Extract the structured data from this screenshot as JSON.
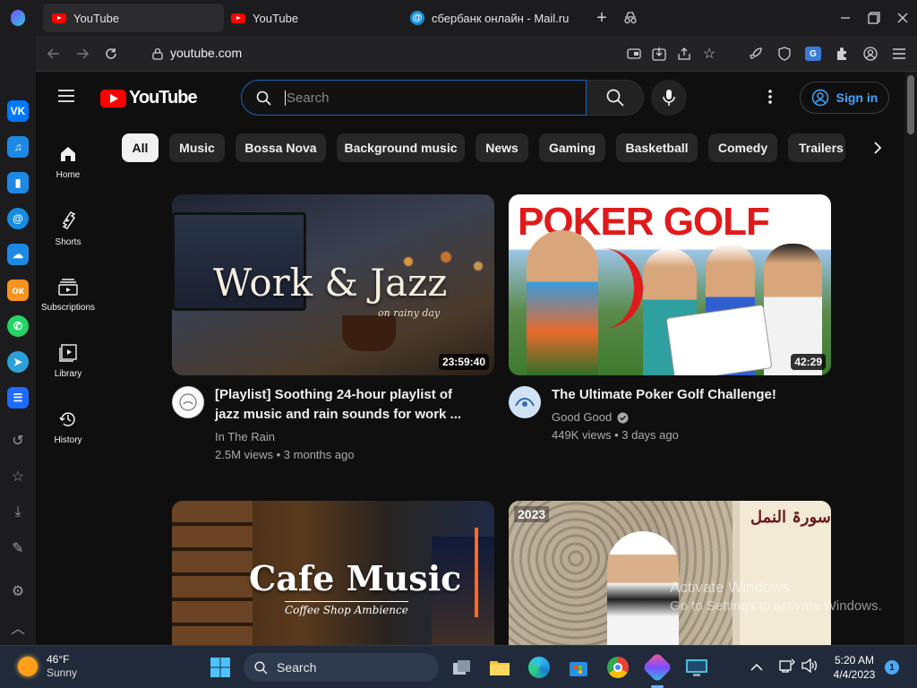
{
  "browser": {
    "tabs": [
      {
        "title": "YouTube",
        "active": true
      },
      {
        "title": "YouTube",
        "active": false
      },
      {
        "title": "сбербанк онлайн - Mail.ru",
        "active": false
      }
    ],
    "url": "youtube.com"
  },
  "youtube": {
    "logo_text": "YouTube",
    "search_placeholder": "Search",
    "sign_in_label": "Sign in",
    "guide": [
      {
        "label": "Home",
        "icon": "home-icon"
      },
      {
        "label": "Shorts",
        "icon": "shorts-icon"
      },
      {
        "label": "Subscriptions",
        "icon": "subscriptions-icon"
      },
      {
        "label": "Library",
        "icon": "library-icon"
      },
      {
        "label": "History",
        "icon": "history-icon"
      }
    ],
    "chips": [
      "All",
      "Music",
      "Bossa Nova",
      "Background music",
      "News",
      "Gaming",
      "Basketball",
      "Comedy",
      "Trailers"
    ],
    "videos": [
      {
        "thumb_text": "Work & Jazz",
        "thumb_subtext": "on rainy day",
        "duration": "23:59:40",
        "title_line1": "[Playlist] Soothing 24-hour playlist of",
        "title_line2": "jazz music and rain sounds for work ...",
        "channel": "In The Rain",
        "stats": "2.5M views • 3 months ago"
      },
      {
        "thumb_text": "POKER GOLF",
        "duration": "42:29",
        "title_line1": "The Ultimate Poker Golf Challenge!",
        "channel": "Good Good",
        "verified": true,
        "stats": "449K views • 3 days ago"
      },
      {
        "thumb_text": "Cafe Music",
        "thumb_subtext": "Coffee Shop Ambience"
      },
      {
        "thumb_badge": "2023",
        "thumb_text": "سورۃ النمل"
      }
    ]
  },
  "watermark": {
    "line1": "Activate Windows",
    "line2": "Go to Settings to activate Windows."
  },
  "taskbar": {
    "weather_temp": "46°F",
    "weather_desc": "Sunny",
    "search_label": "Search",
    "time": "5:20 AM",
    "date": "4/4/2023",
    "notification_count": "1"
  },
  "colors": {
    "yt_red": "#ff0000",
    "link_blue": "#3ea6ff",
    "bg": "#0f0f0f"
  }
}
